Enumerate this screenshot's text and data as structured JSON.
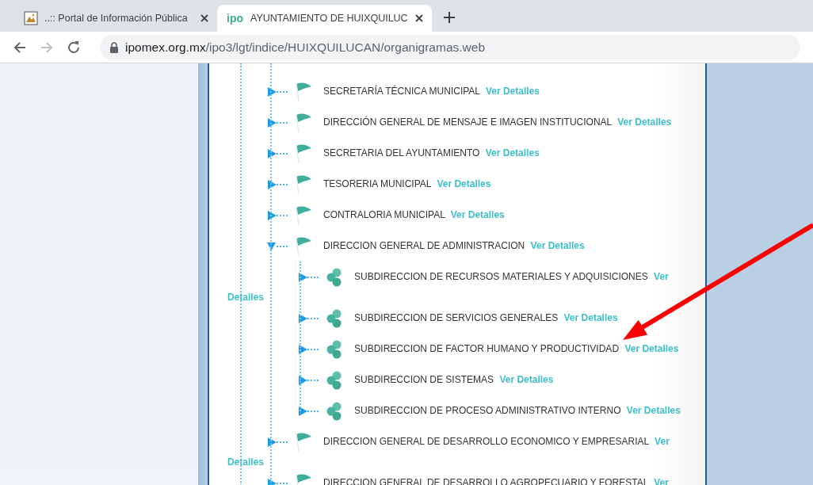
{
  "browser": {
    "tabs": [
      {
        "title": "..:: Portal de Información Pública",
        "selected": false
      },
      {
        "title": "AYUNTAMIENTO DE HUIXQUILUC",
        "selected": true,
        "favicon_text": "ipo"
      }
    ],
    "address": {
      "host": "ipomex.org.mx",
      "path": "/ipo3/lgt/indice/HUIXQUILUCAN/organigramas.web"
    }
  },
  "org_tree": [
    {
      "name": "SECRETARÍA TÉCNICA MUNICIPAL",
      "link": "Ver Detalles",
      "expanded": false
    },
    {
      "name": "DIRECCIÓN GENERAL DE MENSAJE E IMAGEN INSTITUCIONAL",
      "link": "Ver Detalles",
      "expanded": false
    },
    {
      "name": "SECRETARIA DEL AYUNTAMIENTO",
      "link": "Ver Detalles",
      "expanded": false
    },
    {
      "name": "TESORERIA MUNICIPAL",
      "link": "Ver Detalles",
      "expanded": false
    },
    {
      "name": "CONTRALORIA MUNICIPAL",
      "link": "Ver Detalles",
      "expanded": false
    },
    {
      "name": "DIRECCION GENERAL DE ADMINISTRACION",
      "link": "Ver Detalles",
      "expanded": true,
      "children": [
        {
          "name": "SUBDIRECCION DE RECURSOS MATERIALES Y ADQUISICIONES",
          "link": "Ver Detalles",
          "expanded": false
        },
        {
          "name": "SUBDIRECCION DE SERVICIOS GENERALES",
          "link": "Ver Detalles",
          "expanded": false
        },
        {
          "name": "SUBDIRECCION DE FACTOR HUMANO Y PRODUCTIVIDAD",
          "link": "Ver Detalles",
          "expanded": false
        },
        {
          "name": "SUBDIRECCION DE SISTEMAS",
          "link": "Ver Detalles",
          "expanded": false
        },
        {
          "name": "SUBDIRECCION DE PROCESO ADMINISTRATIVO INTERNO",
          "link": "Ver Detalles",
          "expanded": false
        }
      ]
    },
    {
      "name": "DIRECCION GENERAL DE DESARROLLO ECONOMICO Y EMPRESARIAL",
      "link": "Ver Detalles",
      "expanded": false
    },
    {
      "name": "DIRECCION GENERAL DE DESARROLLO AGROPECUARIO Y FORESTAL",
      "link": "Ver",
      "expanded": false
    }
  ]
}
